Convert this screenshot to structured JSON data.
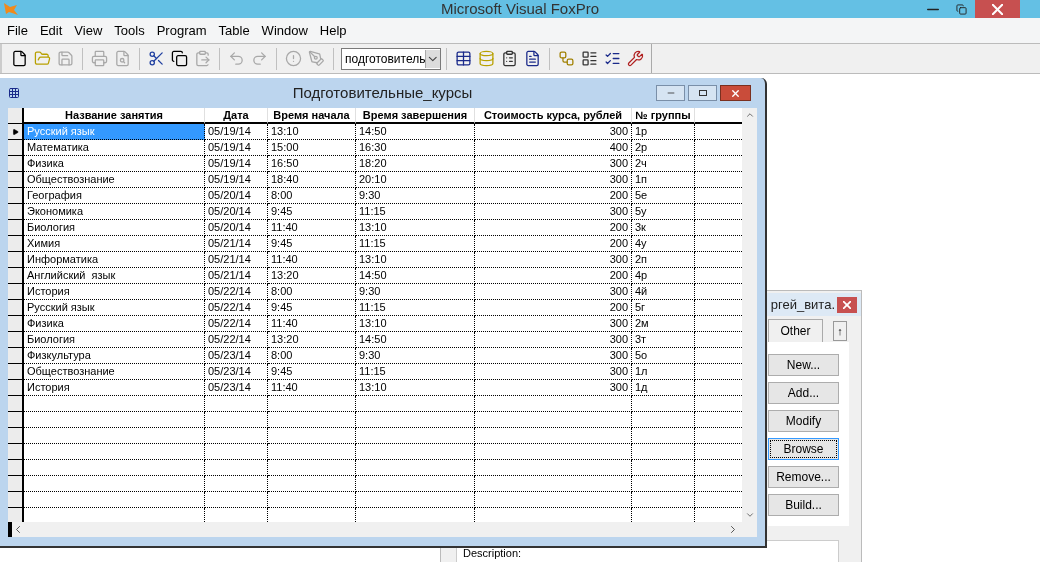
{
  "window": {
    "title": "Microsoft Visual FoxPro"
  },
  "menu": [
    "File",
    "Edit",
    "View",
    "Tools",
    "Program",
    "Table",
    "Window",
    "Help"
  ],
  "toolbar": [
    {
      "kind": "new",
      "disabled": false
    },
    {
      "kind": "open",
      "disabled": false
    },
    {
      "kind": "save",
      "disabled": true
    },
    {
      "kind": "separator"
    },
    {
      "kind": "print",
      "disabled": true
    },
    {
      "kind": "preview",
      "disabled": true
    },
    {
      "kind": "separator"
    },
    {
      "kind": "cut",
      "disabled": false
    },
    {
      "kind": "copy",
      "disabled": false
    },
    {
      "kind": "paste",
      "disabled": true
    },
    {
      "kind": "separator"
    },
    {
      "kind": "undo",
      "disabled": true
    },
    {
      "kind": "redo",
      "disabled": true
    },
    {
      "kind": "separator"
    },
    {
      "kind": "run",
      "disabled": true
    },
    {
      "kind": "modify",
      "disabled": true
    },
    {
      "kind": "separator"
    },
    {
      "kind": "combo",
      "value": "подготовитель"
    },
    {
      "kind": "separator"
    },
    {
      "kind": "table",
      "disabled": false
    },
    {
      "kind": "database",
      "disabled": false
    },
    {
      "kind": "properties",
      "disabled": false
    },
    {
      "kind": "document",
      "disabled": false
    },
    {
      "kind": "separator"
    },
    {
      "kind": "connect",
      "disabled": false
    },
    {
      "kind": "form",
      "disabled": false
    },
    {
      "kind": "checklist",
      "disabled": false
    },
    {
      "kind": "tools",
      "disabled": false
    }
  ],
  "browse": {
    "title": "Подготовительные_курсы",
    "columns": [
      {
        "label": "Название занятия",
        "kind": "text"
      },
      {
        "label": "Дата",
        "kind": "text"
      },
      {
        "label": "Время начала",
        "kind": "text"
      },
      {
        "label": "Время завершения",
        "kind": "text"
      },
      {
        "label": "Стоимость курса, рублей",
        "kind": "number"
      },
      {
        "label": "№ группы",
        "kind": "text"
      }
    ],
    "rows": [
      {
        "selected": true,
        "cells": [
          "Русский язык",
          "05/19/14",
          "13:10",
          "14:50",
          "300",
          "1р"
        ]
      },
      {
        "selected": false,
        "cells": [
          "Математика",
          "05/19/14",
          "15:00",
          "16:30",
          "400",
          "2р"
        ]
      },
      {
        "selected": false,
        "cells": [
          "Физика",
          "05/19/14",
          "16:50",
          "18:20",
          "300",
          "2ч"
        ]
      },
      {
        "selected": false,
        "cells": [
          "Обществознание",
          "05/19/14",
          "18:40",
          "20:10",
          "300",
          "1п"
        ]
      },
      {
        "selected": false,
        "cells": [
          "География",
          "05/20/14",
          "8:00",
          "9:30",
          "200",
          "5е"
        ]
      },
      {
        "selected": false,
        "cells": [
          "Экономика",
          "05/20/14",
          "9:45",
          "11:15",
          "300",
          "5у"
        ]
      },
      {
        "selected": false,
        "cells": [
          "Биология",
          "05/20/14",
          "11:40",
          "13:10",
          "200",
          "3к"
        ]
      },
      {
        "selected": false,
        "cells": [
          "Химия",
          "05/21/14",
          "9:45",
          "11:15",
          "200",
          "4у"
        ]
      },
      {
        "selected": false,
        "cells": [
          "Информатика",
          "05/21/14",
          "11:40",
          "13:10",
          "300",
          "2п"
        ]
      },
      {
        "selected": false,
        "cells": [
          "Английский  язык",
          "05/21/14",
          "13:20",
          "14:50",
          "200",
          "4р"
        ]
      },
      {
        "selected": false,
        "cells": [
          "История",
          "05/22/14",
          "8:00",
          "9:30",
          "300",
          "4й"
        ]
      },
      {
        "selected": false,
        "cells": [
          "Русский язык",
          "05/22/14",
          "9:45",
          "11:15",
          "200",
          "5г"
        ]
      },
      {
        "selected": false,
        "cells": [
          "Физика",
          "05/22/14",
          "11:40",
          "13:10",
          "300",
          "2м"
        ]
      },
      {
        "selected": false,
        "cells": [
          "Биология",
          "05/22/14",
          "13:20",
          "14:50",
          "300",
          "3т"
        ]
      },
      {
        "selected": false,
        "cells": [
          "Физкультура",
          "05/23/14",
          "8:00",
          "9:30",
          "300",
          "5о"
        ]
      },
      {
        "selected": false,
        "cells": [
          "Обществознание",
          "05/23/14",
          "9:45",
          "11:15",
          "300",
          "1л"
        ]
      },
      {
        "selected": false,
        "cells": [
          "История",
          "05/23/14",
          "11:40",
          "13:10",
          "300",
          "1д"
        ]
      }
    ]
  },
  "project": {
    "title": "ргей_вита.",
    "tab": "Other",
    "up_button": "↑",
    "buttons": [
      {
        "label": "New...",
        "focused": false
      },
      {
        "label": "Add...",
        "focused": false
      },
      {
        "label": "Modify",
        "focused": false
      },
      {
        "label": "Browse",
        "focused": true
      },
      {
        "label": "Remove...",
        "focused": false
      },
      {
        "label": "Build...",
        "focused": false
      }
    ],
    "description_label": "Description:"
  }
}
